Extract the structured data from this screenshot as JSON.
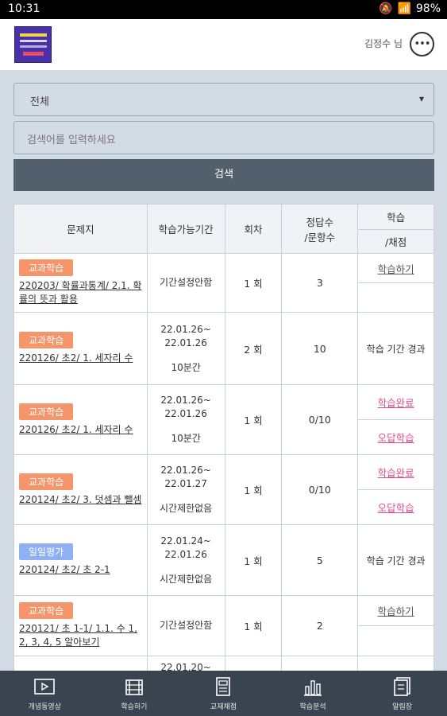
{
  "status": {
    "time": "10:31",
    "battery": "98%"
  },
  "header": {
    "user": "김정수 님",
    "more_icon": "more-horizontal-icon"
  },
  "filter": {
    "selected": "전체",
    "search_placeholder": "검색어를 입력하세요",
    "search_button": "검색"
  },
  "table": {
    "headers": {
      "title": "문제지",
      "period": "학습가능기간",
      "round": "회차",
      "score_l1": "정답수",
      "score_l2": "/문항수",
      "action_l1": "학습",
      "action_l2": "/채점"
    },
    "rows": [
      {
        "badge": "교과학습",
        "title": "220203/ 확률과통계/ 2.1. 확률의 뜻과 활용",
        "period": "기간설정안함",
        "duration": "",
        "round": "1 회",
        "score": "3",
        "action_top": "학습하기",
        "action_bottom": ""
      },
      {
        "badge": "교과학습",
        "title": "220126/ 초2/ 1. 세자리 수",
        "period": "22.01.26~ 22.01.26",
        "duration": "10분간",
        "round": "2 회",
        "score": "10",
        "status": "학습 기간 경과"
      },
      {
        "badge": "교과학습",
        "title": "220126/ 초2/ 1. 세자리 수",
        "period": "22.01.26~ 22.01.26",
        "duration": "10분간",
        "round": "1 회",
        "score": "0/10",
        "action_top": "학습완료",
        "action_bottom": "오답학습"
      },
      {
        "badge": "교과학습",
        "title": "220124/ 초2/ 3. 덧셈과 뺄셈",
        "period": "22.01.26~ 22.01.27",
        "duration": "시간제한없음",
        "round": "1 회",
        "score": "0/10",
        "action_top": "학습완료",
        "action_bottom": "오답학습"
      },
      {
        "badge": "일일평가",
        "title": "220124/ 초2/ 초 2-1",
        "period": "22.01.24~ 22.01.26",
        "duration": "시간제한없음",
        "round": "1 회",
        "score": "5",
        "status": "학습 기간 경과"
      },
      {
        "badge": "교과학습",
        "title": "220121/ 초 1-1/ 1.1. 수 1, 2, 3, 4, 5 알아보기",
        "period": "기간설정안함",
        "duration": "",
        "round": "1 회",
        "score": "2",
        "action_top": "학습하기",
        "action_bottom": ""
      },
      {
        "badge": "",
        "title": "",
        "period": "22.01.20~",
        "duration": "",
        "round": "",
        "score": ""
      }
    ]
  },
  "bottom_nav": [
    {
      "label": "개념동영상",
      "icon": "play-video-icon"
    },
    {
      "label": "학습하기",
      "icon": "film-strip-icon"
    },
    {
      "label": "교재채점",
      "icon": "document-icon"
    },
    {
      "label": "학습분석",
      "icon": "bar-chart-icon"
    },
    {
      "label": "알림장",
      "icon": "notebook-icon"
    }
  ],
  "colors": {
    "accent_orange": "#f4956b",
    "accent_blue": "#8fb0f2",
    "pink": "#e0508a",
    "nav_bg": "#3a4350",
    "search_btn": "#52606e"
  }
}
